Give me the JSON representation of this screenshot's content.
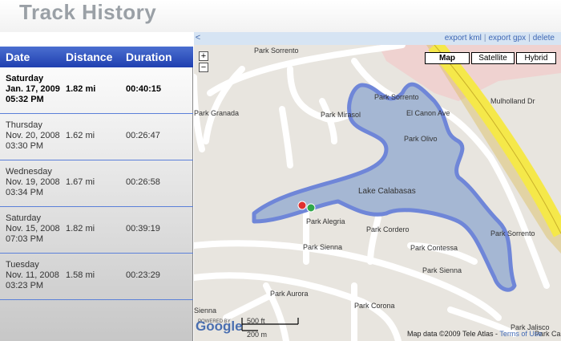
{
  "app": {
    "title": "Track History"
  },
  "columns": {
    "date": "Date",
    "distance": "Distance",
    "duration": "Duration"
  },
  "tracks": [
    {
      "weekday": "Saturday",
      "date": "Jan. 17, 2009",
      "time": "05:32 PM",
      "distance": "1.82 mi",
      "duration": "00:40:15",
      "selected": true
    },
    {
      "weekday": "Thursday",
      "date": "Nov. 20, 2008",
      "time": "03:30 PM",
      "distance": "1.62 mi",
      "duration": "00:26:47"
    },
    {
      "weekday": "Wednesday",
      "date": "Nov. 19, 2008",
      "time": "03:34 PM",
      "distance": "1.67 mi",
      "duration": "00:26:58"
    },
    {
      "weekday": "Saturday",
      "date": "Nov. 15, 2008",
      "time": "07:03 PM",
      "distance": "1.82 mi",
      "duration": "00:39:19"
    },
    {
      "weekday": "Tuesday",
      "date": "Nov. 11, 2008",
      "time": "03:23 PM",
      "distance": "1.58 mi",
      "duration": "00:23:29"
    }
  ],
  "toolbar": {
    "collapse": "<",
    "export_kml": "export kml",
    "export_gpx": "export gpx",
    "delete": "delete",
    "separator": "|"
  },
  "map": {
    "zoom_in": "+",
    "zoom_out": "−",
    "types": [
      "Map",
      "Satellite",
      "Hybrid"
    ],
    "active_type": "Map",
    "scale_imperial": "500 ft",
    "scale_metric": "200 m",
    "attribution": "Map data ©2009 Tele Atlas - ",
    "terms": "Terms of Use",
    "logo": "Google",
    "powered": "POWERED BY",
    "labels": {
      "park_sorrento_top": "Park Sorrento",
      "park_sorrento_mid": "Park Sorrento",
      "park_sorrento_right": "Park Sorrento",
      "el_canon": "El Canon Ave",
      "park_mirasol": "Park Mirasol",
      "park_olivo": "Park Olivo",
      "mulholland": "Mulholland Dr",
      "lake": "Lake Calabasas",
      "park_granada": "Park Granada",
      "park_alegria": "Park Alegria",
      "park_cordero": "Park Cordero",
      "park_contessa": "Park Contessa",
      "park_sienna_left": "Park Sienna",
      "park_sienna_right": "Park Sienna",
      "park_aurora": "Park Aurora",
      "park_corona": "Park Corona",
      "park_jalisco": "Park Jalisco",
      "sienna_bottom": "Sienna",
      "park_ca": "Park Ca"
    },
    "colors": {
      "water": "#a5b7d3",
      "track": "#6f86d8",
      "road": "#ffffff",
      "highway": "#f5e84a",
      "land": "#e8e5df",
      "park": "#efd2d0"
    }
  }
}
